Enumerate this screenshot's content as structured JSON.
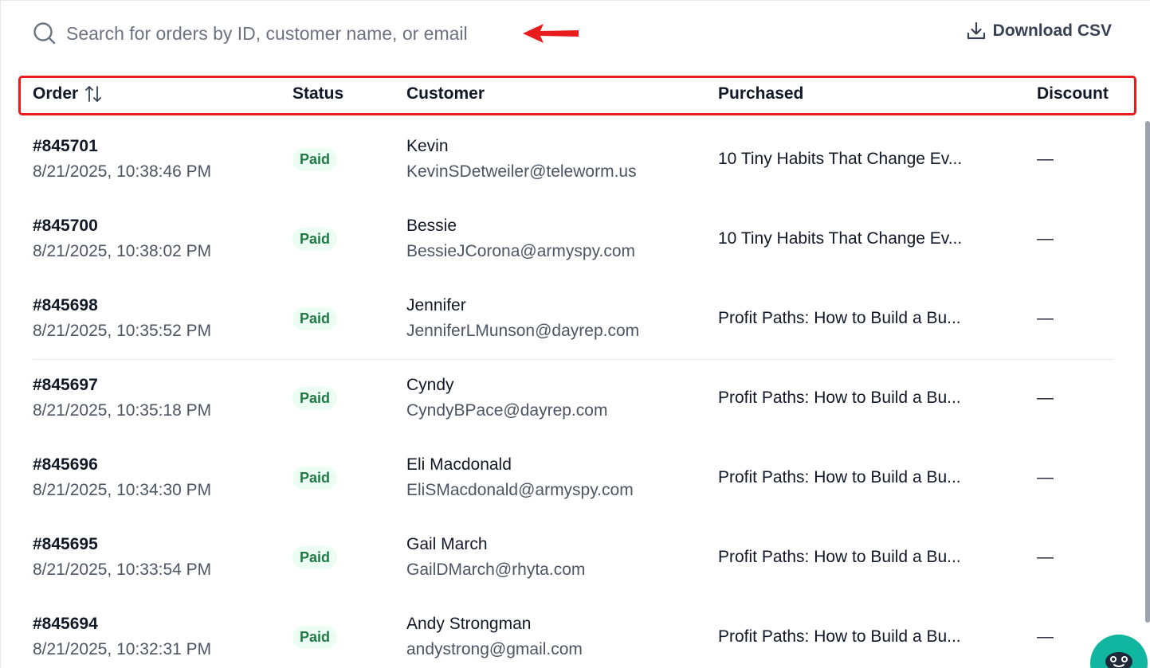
{
  "search": {
    "placeholder": "Search for orders by ID, customer name, or email"
  },
  "toolbar": {
    "download_label": "Download CSV"
  },
  "table": {
    "columns": {
      "order": "Order",
      "status": "Status",
      "customer": "Customer",
      "purchased": "Purchased",
      "discount": "Discount"
    },
    "rows": [
      {
        "id": "#845701",
        "date": "8/21/2025, 10:38:46 PM",
        "status": "Paid",
        "name": "Kevin",
        "email": "KevinSDetweiler@teleworm.us",
        "purchased": "10 Tiny Habits That Change Ev...",
        "discount": "—"
      },
      {
        "id": "#845700",
        "date": "8/21/2025, 10:38:02 PM",
        "status": "Paid",
        "name": "Bessie",
        "email": "BessieJCorona@armyspy.com",
        "purchased": "10 Tiny Habits That Change Ev...",
        "discount": "—"
      },
      {
        "id": "#845698",
        "date": "8/21/2025, 10:35:52 PM",
        "status": "Paid",
        "name": "Jennifer",
        "email": "JenniferLMunson@dayrep.com",
        "purchased": "Profit Paths: How to Build a Bu...",
        "discount": "—"
      },
      {
        "id": "#845697",
        "date": "8/21/2025, 10:35:18 PM",
        "status": "Paid",
        "name": "Cyndy",
        "email": "CyndyBPace@dayrep.com",
        "purchased": "Profit Paths: How to Build a Bu...",
        "discount": "—"
      },
      {
        "id": "#845696",
        "date": "8/21/2025, 10:34:30 PM",
        "status": "Paid",
        "name": "Eli Macdonald",
        "email": "EliSMacdonald@armyspy.com",
        "purchased": "Profit Paths: How to Build a Bu...",
        "discount": "—"
      },
      {
        "id": "#845695",
        "date": "8/21/2025, 10:33:54 PM",
        "status": "Paid",
        "name": "Gail March",
        "email": "GailDMarch@rhyta.com",
        "purchased": "Profit Paths: How to Build a Bu...",
        "discount": "—"
      },
      {
        "id": "#845694",
        "date": "8/21/2025, 10:32:31 PM",
        "status": "Paid",
        "name": "Andy Strongman",
        "email": "andystrong@gmail.com",
        "purchased": "Profit Paths: How to Build a Bu...",
        "discount": "—"
      }
    ]
  },
  "colors": {
    "annotation_red": "#e81c1c",
    "paid_badge_bg": "#ecfdf3",
    "paid_badge_text": "#1f7a44",
    "chat_bubble": "#10b6a0"
  },
  "icons": {
    "search": "search-icon",
    "download": "download-icon",
    "sort": "sort-arrows-icon",
    "annotation": "red-arrow-icon",
    "chat": "chat-avatar-icon"
  }
}
